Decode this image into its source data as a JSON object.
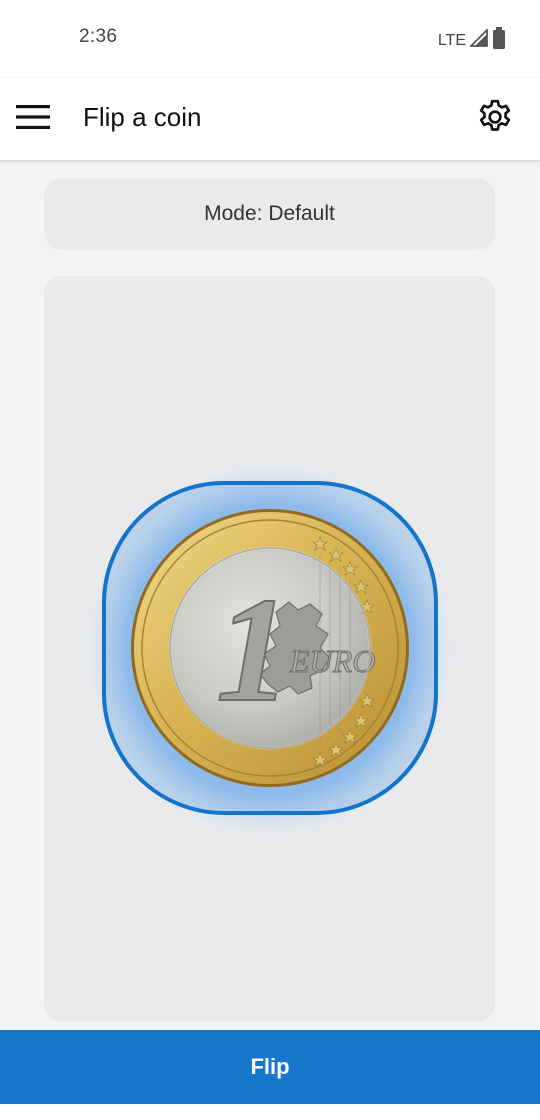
{
  "status_bar": {
    "time": "2:36",
    "network": "LTE",
    "signal_icon": "signal-icon",
    "battery_icon": "battery-icon"
  },
  "app_bar": {
    "title": "Flip a coin",
    "menu_icon": "hamburger-menu-icon",
    "settings_icon": "gear-icon"
  },
  "mode": {
    "label": "Mode: Default"
  },
  "coin": {
    "denomination": "1",
    "currency": "EURO",
    "image_name": "one-euro-coin"
  },
  "actions": {
    "flip_label": "Flip"
  },
  "colors": {
    "accent": "#1576cc",
    "card_background": "#e9eaec",
    "coin_ring": "#d9b760",
    "coin_center": "#c7c8c2"
  }
}
